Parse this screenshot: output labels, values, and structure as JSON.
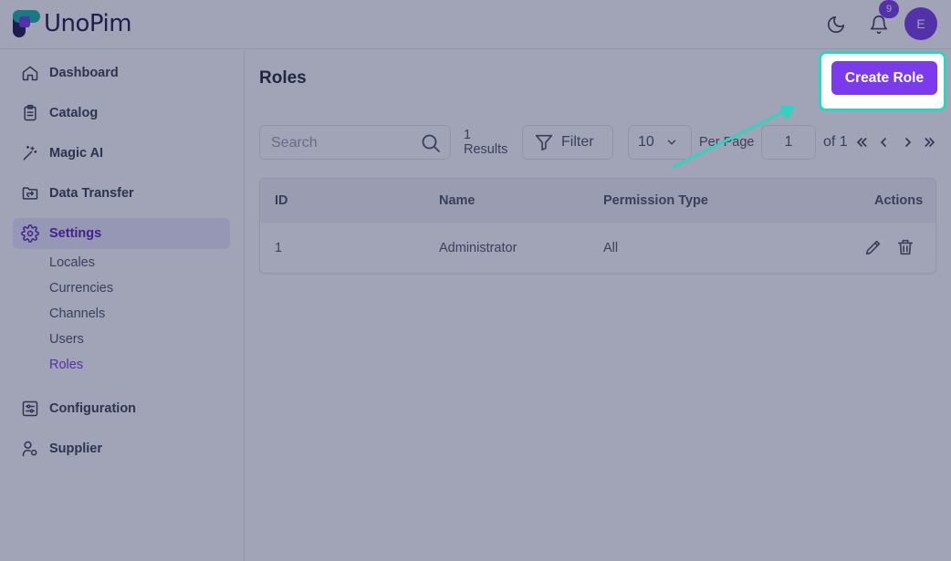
{
  "app": {
    "logo_text": "UnoPim",
    "notification_count": "9",
    "avatar_initial": "E"
  },
  "sidebar": {
    "items": [
      {
        "label": "Dashboard",
        "icon": "home-icon"
      },
      {
        "label": "Catalog",
        "icon": "clipboard-icon"
      },
      {
        "label": "Magic AI",
        "icon": "magic-wand-icon"
      },
      {
        "label": "Data Transfer",
        "icon": "folder-transfer-icon"
      },
      {
        "label": "Settings",
        "icon": "gear-icon",
        "active": true
      },
      {
        "label": "Configuration",
        "icon": "sliders-icon"
      },
      {
        "label": "Supplier",
        "icon": "user-gear-icon"
      }
    ],
    "settings_sub": [
      "Locales",
      "Currencies",
      "Channels",
      "Users",
      "Roles"
    ],
    "active_sub": "Roles"
  },
  "page": {
    "title": "Roles",
    "create_button": "Create Role"
  },
  "toolbar": {
    "search_placeholder": "Search",
    "results_count": "1",
    "results_label": "Results",
    "filter_label": "Filter",
    "per_page_value": "10",
    "per_page_label": "Per Page",
    "page_value": "1",
    "of_label": "of 1"
  },
  "table": {
    "headers": [
      "ID",
      "Name",
      "Permission Type",
      "Actions"
    ],
    "rows": [
      {
        "id": "1",
        "name": "Administrator",
        "permission_type": "All"
      }
    ]
  },
  "colors": {
    "accent": "#7c3aed",
    "highlight_ring": "#2dd4bf",
    "overlay": "#1e2350"
  }
}
